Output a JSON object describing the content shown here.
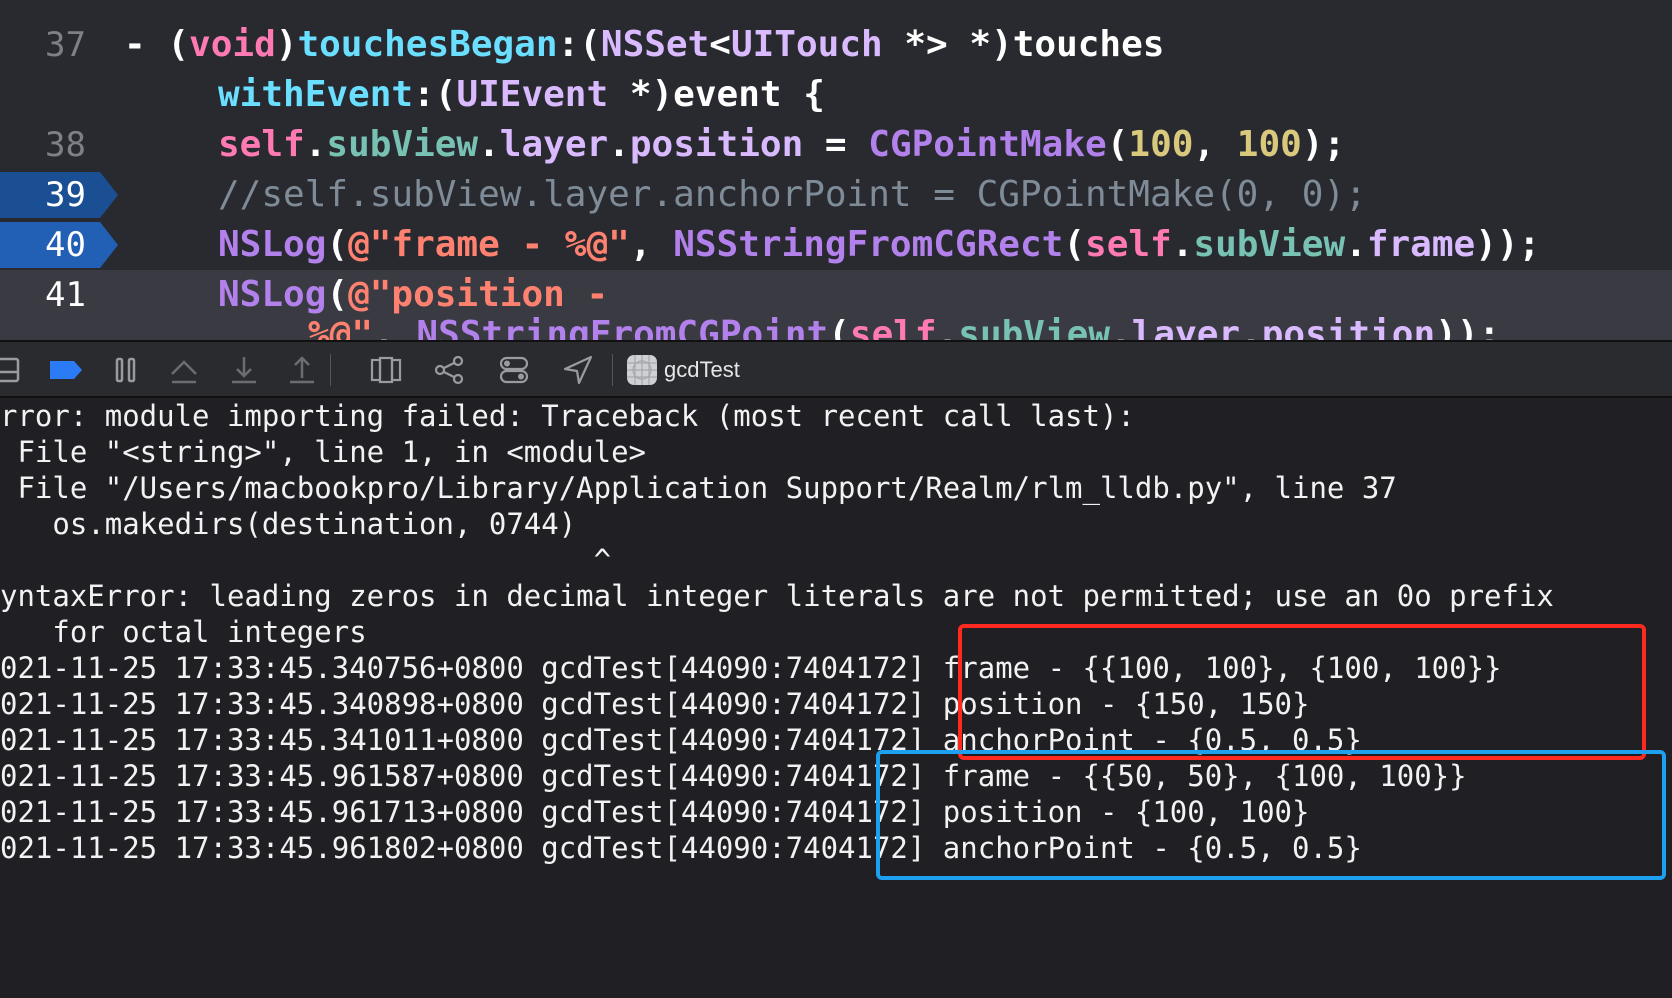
{
  "editor": {
    "lines": [
      {
        "number": "37",
        "segments": [
          {
            "t": "- ",
            "c": "plain"
          },
          {
            "t": "(",
            "c": "plain"
          },
          {
            "t": "void",
            "c": "kw"
          },
          {
            "t": ")",
            "c": "plain"
          },
          {
            "t": "touchesBegan",
            "c": "method"
          },
          {
            "t": ":(",
            "c": "plain"
          },
          {
            "t": "NSSet",
            "c": "type"
          },
          {
            "t": "<",
            "c": "plain"
          },
          {
            "t": "UITouch",
            "c": "type"
          },
          {
            "t": " *> *)touches",
            "c": "plain"
          }
        ]
      },
      {
        "number": "",
        "segments": [
          {
            "t": "withEvent",
            "c": "method"
          },
          {
            "t": ":(",
            "c": "plain"
          },
          {
            "t": "UIEvent",
            "c": "type"
          },
          {
            "t": " *)event {",
            "c": "plain"
          }
        ]
      },
      {
        "number": "38",
        "segments": [
          {
            "t": "self",
            "c": "kw"
          },
          {
            "t": ".",
            "c": "plain"
          },
          {
            "t": "subView",
            "c": "prop"
          },
          {
            "t": ".",
            "c": "plain"
          },
          {
            "t": "layer",
            "c": "type"
          },
          {
            "t": ".",
            "c": "plain"
          },
          {
            "t": "position",
            "c": "type"
          },
          {
            "t": " = ",
            "c": "plain"
          },
          {
            "t": "CGPointMake",
            "c": "fn"
          },
          {
            "t": "(",
            "c": "plain"
          },
          {
            "t": "100",
            "c": "num"
          },
          {
            "t": ", ",
            "c": "plain"
          },
          {
            "t": "100",
            "c": "num"
          },
          {
            "t": ");",
            "c": "plain"
          }
        ]
      },
      {
        "number": "39",
        "breakpoint": true,
        "segments": [
          {
            "t": "//self.subView.layer.anchorPoint = CGPointMake(0, 0);",
            "c": "cmt"
          }
        ]
      },
      {
        "number": "40",
        "breakpoint": true,
        "segments": [
          {
            "t": "NSLog",
            "c": "fn"
          },
          {
            "t": "(",
            "c": "plain"
          },
          {
            "t": "@\"frame - %@\"",
            "c": "str"
          },
          {
            "t": ", ",
            "c": "plain"
          },
          {
            "t": "NSStringFromCGRect",
            "c": "fn"
          },
          {
            "t": "(",
            "c": "plain"
          },
          {
            "t": "self",
            "c": "kw"
          },
          {
            "t": ".",
            "c": "plain"
          },
          {
            "t": "subView",
            "c": "prop"
          },
          {
            "t": ".",
            "c": "plain"
          },
          {
            "t": "frame",
            "c": "type"
          },
          {
            "t": "));",
            "c": "plain"
          }
        ]
      },
      {
        "number": "41",
        "current": true,
        "segments": [
          {
            "t": "NSLog",
            "c": "fn"
          },
          {
            "t": "(",
            "c": "plain"
          },
          {
            "t": "@\"position -",
            "c": "str"
          }
        ]
      },
      {
        "number": "",
        "current": true,
        "segments": [
          {
            "t": "%@\"",
            "c": "str"
          },
          {
            "t": ", ",
            "c": "plain"
          },
          {
            "t": "NSStringFromCGPoint",
            "c": "fn"
          },
          {
            "t": "(",
            "c": "plain"
          },
          {
            "t": "self",
            "c": "kw"
          },
          {
            "t": ".",
            "c": "plain"
          },
          {
            "t": "subView",
            "c": "prop"
          },
          {
            "t": ".",
            "c": "plain"
          },
          {
            "t": "layer",
            "c": "type"
          },
          {
            "t": ".",
            "c": "plain"
          },
          {
            "t": "position",
            "c": "type"
          },
          {
            "t": "));",
            "c": "plain"
          }
        ]
      }
    ]
  },
  "debug_bar": {
    "target_name": "gcdTest",
    "buttons": [
      "hide-debug-area-icon",
      "breakpoints-toggle-icon",
      "pause-icon",
      "step-over-icon",
      "step-into-icon",
      "step-out-icon",
      "view-debugger-icon",
      "memory-graph-icon",
      "environment-overrides-icon",
      "simulate-location-icon"
    ]
  },
  "console": {
    "lines": [
      "rror: module importing failed: Traceback (most recent call last):",
      " File \"<string>\", line 1, in <module>",
      " File \"/Users/macbookpro/Library/Application Support/Realm/rlm_lldb.py\", line 37",
      "   os.makedirs(destination, 0744)",
      "                                  ^",
      "yntaxError: leading zeros in decimal integer literals are not permitted; use an 0o prefix",
      "   for octal integers",
      "021-11-25 17:33:45.340756+0800 gcdTest[44090:7404172] frame - {{100, 100}, {100, 100}}",
      "021-11-25 17:33:45.340898+0800 gcdTest[44090:7404172] position - {150, 150}",
      "021-11-25 17:33:45.341011+0800 gcdTest[44090:7404172] anchorPoint - {0.5, 0.5}",
      "021-11-25 17:33:45.961587+0800 gcdTest[44090:7404172] frame - {{50, 50}, {100, 100}}",
      "021-11-25 17:33:45.961713+0800 gcdTest[44090:7404172] position - {100, 100}",
      "021-11-25 17:33:45.961802+0800 gcdTest[44090:7404172] anchorPoint - {0.5, 0.5}"
    ]
  },
  "annotations": {
    "red_box_color": "#ff2a1f",
    "blue_box_color": "#1ea0f0"
  }
}
